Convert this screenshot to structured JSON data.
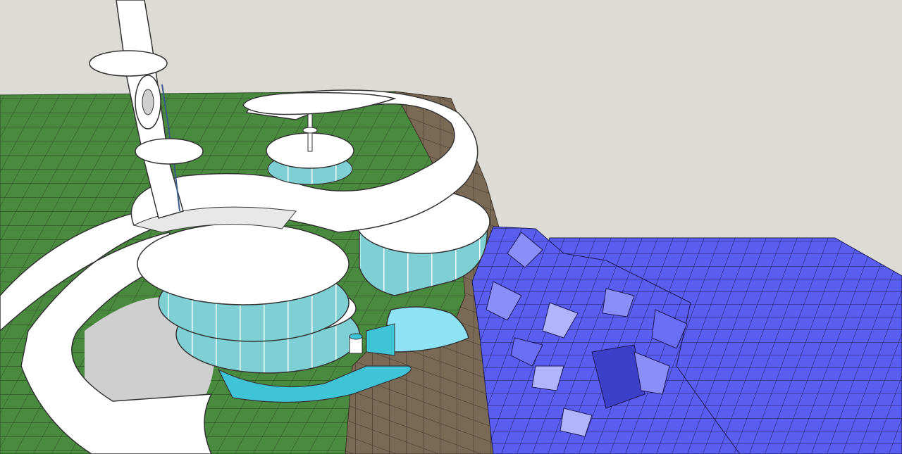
{
  "scene": {
    "colors": {
      "sky": "#dcdbd6",
      "grass": "#4a8a3e",
      "grass_line": "#2a4a24",
      "cliff": "#7a6a55",
      "cliff_line": "#3a3025",
      "water": "#5a5ef0",
      "water_light": "#8a8ef8",
      "water_line": "#1a1a55",
      "building": "#ffffff",
      "glass": "#7fd0d4",
      "pool": "#8ee4f4",
      "shadow": "#cfcfcf",
      "edge": "#333333"
    }
  }
}
